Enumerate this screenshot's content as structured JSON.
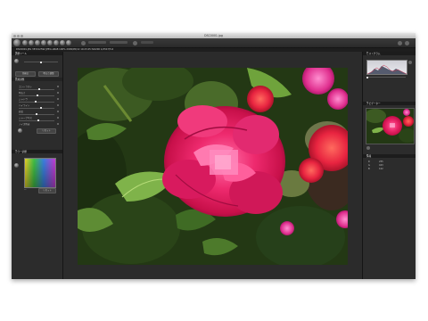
{
  "window": {
    "title": "DSC0001.jpg"
  },
  "toolbar": {
    "tool_icons": [
      "tool-icon-1",
      "tool-icon-2",
      "tool-icon-3",
      "tool-icon-4",
      "tool-icon-5",
      "tool-icon-6",
      "tool-icon-7",
      "tool-icon-8",
      "tool-icon-9"
    ]
  },
  "status_bar": {
    "text": "DSC0001.JPG 3872x2592 JPEG sRGB 100% 2009/05/12 10:23:45 ISO200 1/250 f/5.6"
  },
  "left_panel": {
    "header1": "調整ツール",
    "button_1": "色補正",
    "button_2": "明るさ調整",
    "section_label": "画質調整",
    "rows": [
      "コントラスト",
      "明るさ",
      "シャドウ",
      "ハイライト",
      "彩度",
      "シャープネス",
      "ノイズ除去"
    ],
    "apply_button": "リセット",
    "header2": "カラー調整",
    "color_reset": "リセット"
  },
  "right_panel": {
    "histogram_header": "ヒストグラム",
    "navigator_header": "ナビゲーター",
    "info_header": "情報",
    "info_rows": [
      {
        "k": "R",
        "v": "255"
      },
      {
        "k": "G",
        "v": "043"
      },
      {
        "k": "B",
        "v": "102"
      }
    ]
  },
  "colors": {
    "window_bg": "#262626",
    "panel_bg": "#2c2c2c",
    "accent": "#e6236b"
  }
}
